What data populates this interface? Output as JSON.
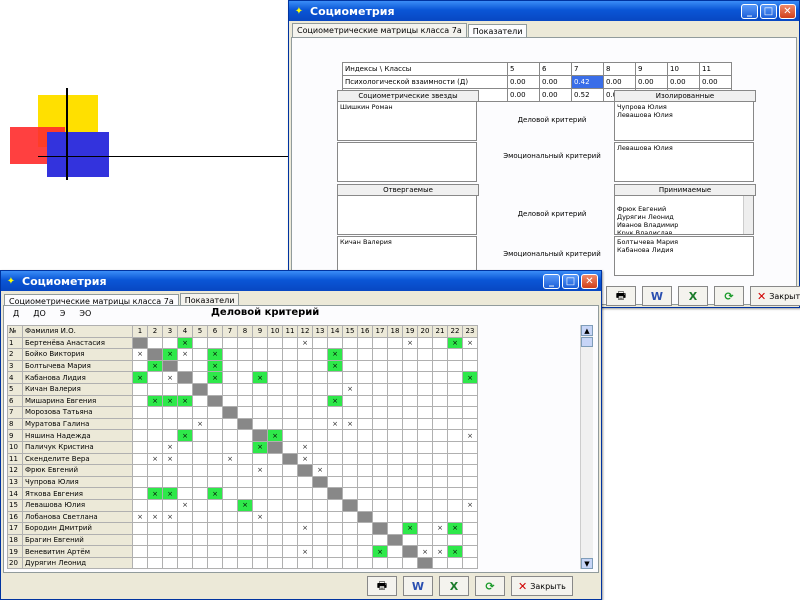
{
  "back": {
    "title": "Социометрия",
    "tabs": [
      "Социометрические матрицы класса 7а",
      "Показатели"
    ],
    "index_table": {
      "headers": [
        "Индексы \\ Классы",
        "5",
        "6",
        "7",
        "8",
        "9",
        "10",
        "11"
      ],
      "rows": [
        [
          "Психологической взаимности (Д)",
          "0.00",
          "0.00",
          "0.42",
          "0.00",
          "0.00",
          "0.00",
          "0.00"
        ],
        [
          "Психологической взаимности (Э)",
          "0.00",
          "0.00",
          "0.52",
          "0.00",
          "0.00",
          "0.00",
          "0.00"
        ]
      ]
    },
    "stars_header": "Социометрические звезды",
    "stars_business": "Шишкин Роман",
    "stars_emotional": "",
    "isolated_header": "Изолированные",
    "isolated_business": "Чупрова Юлия\nЛевашова Юлия",
    "isolated_emotional": "Левашова Юлия",
    "business_criterion": "Деловой критерий",
    "emotional_criterion": "Эмоциональный критерий",
    "rejected_header": "Отвергаемые",
    "rejected_business": "",
    "rejected_emotional": "Кичан Валерия",
    "accepted_header": "Принимаемые",
    "accepted_business": "Фрюк Евгений\nДурягин Леонид\nИванов Владимир\nКрук Владислав",
    "accepted_emotional": "Болтычева Мария\nКабанова Лидия",
    "close_label": "Закрыть"
  },
  "front": {
    "title": "Социометрия",
    "tabs": [
      "Социометрические матрицы класса 7а",
      "Показатели"
    ],
    "subtabs": [
      "Д",
      "ДО",
      "Э",
      "ЭО"
    ],
    "grid_title": "Деловой критерий",
    "col_no": "№",
    "col_name": "Фамилия И.О.",
    "columns": [
      "1",
      "2",
      "3",
      "4",
      "5",
      "6",
      "7",
      "8",
      "9",
      "10",
      "11",
      "12",
      "13",
      "14",
      "15",
      "16",
      "17",
      "18",
      "19",
      "20",
      "21",
      "22",
      "23"
    ],
    "students": [
      {
        "n": "1",
        "name": "Бертенёва Анастасия",
        "neg": [
          12,
          19,
          23
        ],
        "pos": [
          4,
          22
        ]
      },
      {
        "n": "2",
        "name": "Бойко Виктория",
        "neg": [
          1,
          4
        ],
        "pos": [
          3,
          6,
          14
        ]
      },
      {
        "n": "3",
        "name": "Болтычева Мария",
        "neg": [],
        "pos": [
          2,
          6,
          14
        ]
      },
      {
        "n": "4",
        "name": "Кабанова Лидия",
        "neg": [
          3
        ],
        "pos": [
          1,
          6,
          9,
          23
        ]
      },
      {
        "n": "5",
        "name": "Кичан Валерия",
        "neg": [
          15
        ],
        "pos": []
      },
      {
        "n": "6",
        "name": "Мишарина Евгения",
        "neg": [],
        "pos": [
          2,
          3,
          4,
          14
        ]
      },
      {
        "n": "7",
        "name": "Морозова Татьяна",
        "neg": [],
        "pos": []
      },
      {
        "n": "8",
        "name": "Муратова Галина",
        "neg": [
          5,
          14,
          15
        ],
        "pos": []
      },
      {
        "n": "9",
        "name": "Няшина Надежда",
        "neg": [
          23
        ],
        "pos": [
          4,
          10
        ]
      },
      {
        "n": "10",
        "name": "Паличук Кристина",
        "neg": [
          3,
          12
        ],
        "pos": [
          9
        ]
      },
      {
        "n": "11",
        "name": "Скенделите Вера",
        "neg": [
          2,
          3,
          7,
          12
        ],
        "pos": []
      },
      {
        "n": "12",
        "name": "Фрюк Евгений",
        "neg": [
          9,
          13
        ],
        "pos": []
      },
      {
        "n": "13",
        "name": "Чупрова Юлия",
        "neg": [],
        "pos": []
      },
      {
        "n": "14",
        "name": "Яткова Евгения",
        "neg": [],
        "pos": [
          2,
          3,
          6
        ]
      },
      {
        "n": "15",
        "name": "Левашова Юлия",
        "neg": [
          4,
          23
        ],
        "pos": [
          8
        ]
      },
      {
        "n": "16",
        "name": "Лобанова Светлана",
        "neg": [
          1,
          2,
          3,
          9
        ],
        "pos": []
      },
      {
        "n": "17",
        "name": "Бородин Дмитрий",
        "neg": [
          12,
          21
        ],
        "pos": [
          19,
          22
        ]
      },
      {
        "n": "18",
        "name": "Брагин Евгений",
        "neg": [],
        "pos": []
      },
      {
        "n": "19",
        "name": "Веневитин Артём",
        "neg": [
          12,
          20,
          21
        ],
        "pos": [
          17,
          22
        ]
      },
      {
        "n": "20",
        "name": "Дурягин Леонид",
        "neg": [],
        "pos": []
      }
    ],
    "close_label": "Закрыть"
  }
}
